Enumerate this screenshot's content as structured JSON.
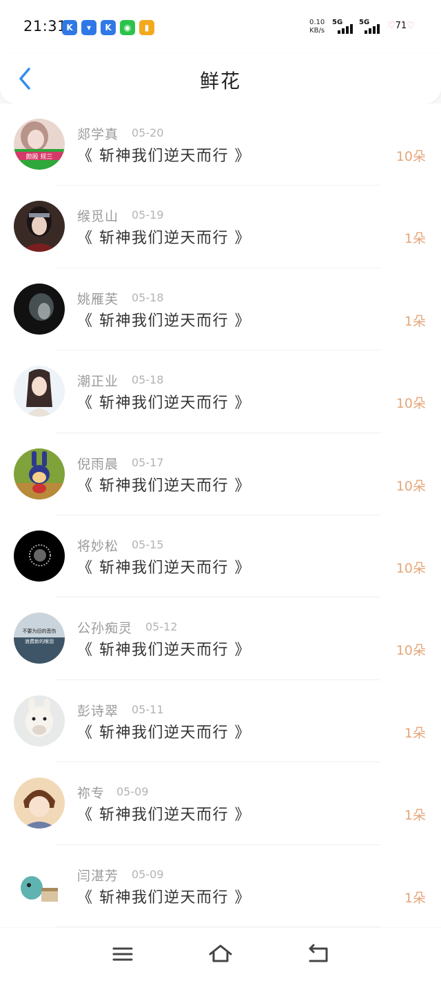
{
  "status": {
    "time": "21:31",
    "net_speed_value": "0.10",
    "net_speed_unit": "KB/s",
    "sim1": "5G",
    "sim2": "5G",
    "battery": "71"
  },
  "app_icons": [
    {
      "icon": "k-app-icon",
      "color": "#2f78e6",
      "glyph": "K"
    },
    {
      "icon": "downloader-icon",
      "color": "#2f78e6",
      "glyph": "▾"
    },
    {
      "icon": "k-app-icon",
      "color": "#2f78e6",
      "glyph": "K"
    },
    {
      "icon": "wechat-icon",
      "color": "#2bc44a",
      "glyph": "◉"
    },
    {
      "icon": "notes-icon",
      "color": "#f3a91d",
      "glyph": "▮"
    }
  ],
  "header": {
    "title": "鲜花"
  },
  "colors": {
    "accent_blue": "#2e8ff0",
    "count_orange": "#e5a67a"
  },
  "items": [
    {
      "name": "郯学真",
      "date": "05-20",
      "book": "《 斩神我们逆天而行 》",
      "count": "10朵"
    },
    {
      "name": "缑觅山",
      "date": "05-19",
      "book": "《 斩神我们逆天而行 》",
      "count": "1朵"
    },
    {
      "name": "姚雁芙",
      "date": "05-18",
      "book": "《 斩神我们逆天而行 》",
      "count": "1朵"
    },
    {
      "name": "潮正业",
      "date": "05-18",
      "book": "《 斩神我们逆天而行 》",
      "count": "10朵"
    },
    {
      "name": "倪雨晨",
      "date": "05-17",
      "book": "《 斩神我们逆天而行 》",
      "count": "10朵"
    },
    {
      "name": "将妙松",
      "date": "05-15",
      "book": "《 斩神我们逆天而行 》",
      "count": "10朵"
    },
    {
      "name": "公孙痴灵",
      "date": "05-12",
      "book": "《 斩神我们逆天而行 》",
      "count": "10朵"
    },
    {
      "name": "彭诗翠",
      "date": "05-11",
      "book": "《 斩神我们逆天而行 》",
      "count": "1朵"
    },
    {
      "name": "祢专",
      "date": "05-09",
      "book": "《 斩神我们逆天而行 》",
      "count": "1朵"
    },
    {
      "name": "闫湛芳",
      "date": "05-09",
      "book": "《 斩神我们逆天而行 》",
      "count": "1朵"
    }
  ],
  "avatar_text": {
    "item0": "颜殿 规三",
    "item6_line1": "不要为旧的悲伤",
    "item6_line2": "浪费新的眼泪"
  }
}
